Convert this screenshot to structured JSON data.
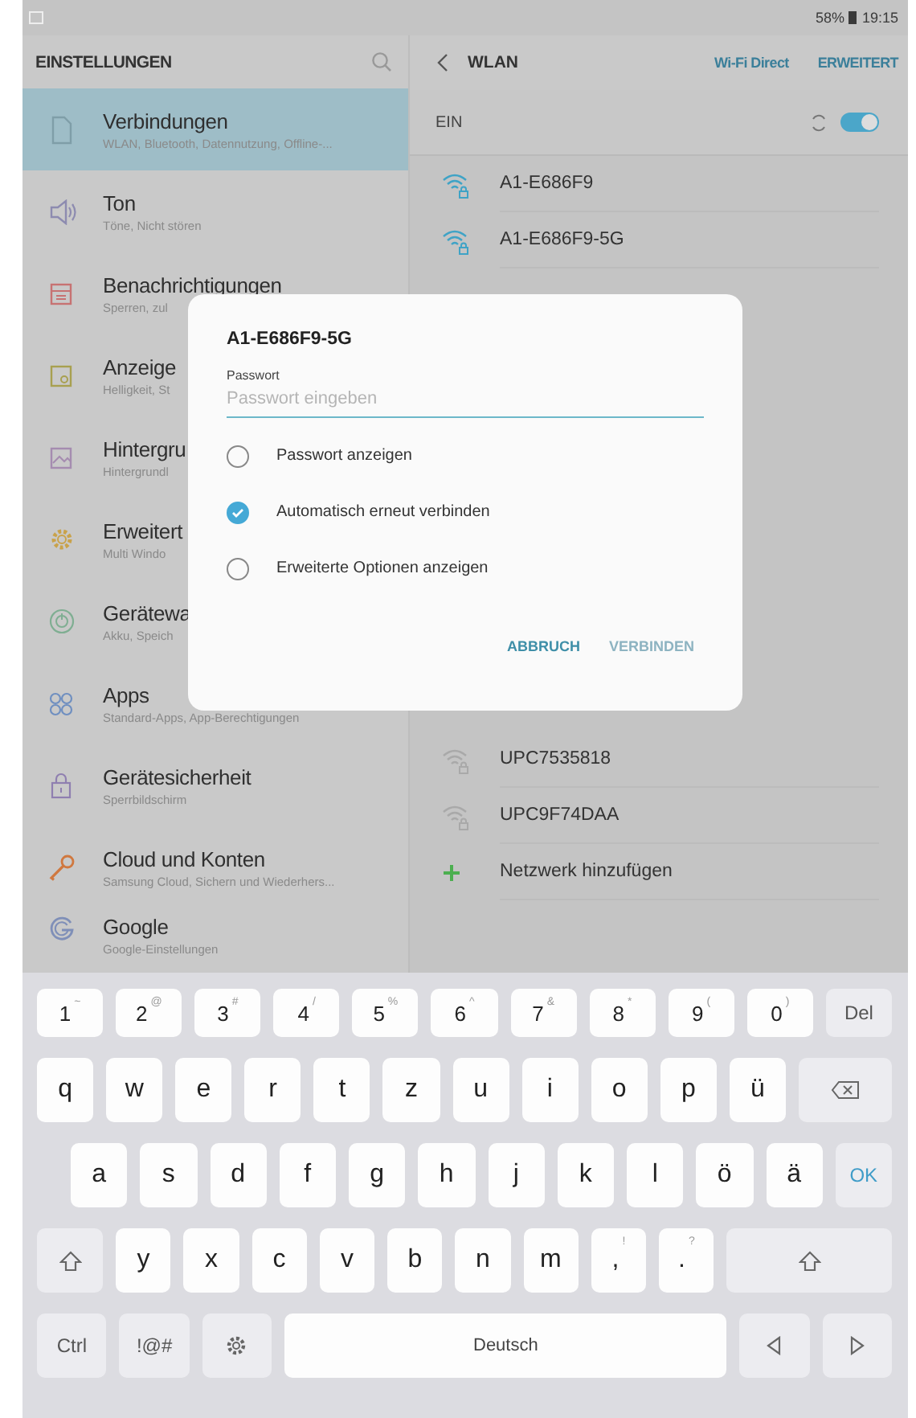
{
  "status_bar": {
    "battery": "58%",
    "time": "19:15"
  },
  "sidebar": {
    "title": "EINSTELLUNGEN",
    "items": [
      {
        "kind": "connections",
        "title": "Verbindungen",
        "subtitle": "WLAN, Bluetooth, Datennutzung, Offline-...",
        "selected": true
      },
      {
        "kind": "sound",
        "title": "Ton",
        "subtitle": "Töne, Nicht stören",
        "selected": false
      },
      {
        "kind": "notifications",
        "title": "Benachrichtigungen",
        "subtitle": "Sperren, zul",
        "selected": false
      },
      {
        "kind": "display",
        "title": "Anzeige",
        "subtitle": "Helligkeit, St",
        "selected": false
      },
      {
        "kind": "wallpaper",
        "title": "Hintergru",
        "subtitle": "Hintergrundl",
        "selected": false
      },
      {
        "kind": "advanced",
        "title": "Erweitert",
        "subtitle": "Multi Windo",
        "selected": false
      },
      {
        "kind": "maintenance",
        "title": "Gerätewa",
        "subtitle": "Akku, Speich",
        "selected": false
      },
      {
        "kind": "apps",
        "title": "Apps",
        "subtitle": "Standard-Apps, App-Berechtigungen",
        "selected": false
      },
      {
        "kind": "security",
        "title": "Gerätesicherheit",
        "subtitle": "Sperrbildschirm",
        "selected": false
      },
      {
        "kind": "cloud",
        "title": "Cloud und Konten",
        "subtitle": "Samsung Cloud, Sichern und Wiederhers...",
        "selected": false
      },
      {
        "kind": "google",
        "title": "Google",
        "subtitle": "Google-Einstellungen",
        "selected": false
      }
    ]
  },
  "wlan": {
    "title": "WLAN",
    "actions": [
      "Wi-Fi Direct",
      "ERWEITERT"
    ],
    "switch": {
      "label": "EIN",
      "on": true
    },
    "networks": [
      {
        "kind": "network",
        "name": "A1-E686F9",
        "color": "#3fa3c6"
      },
      {
        "kind": "network",
        "name": "A1-E686F9-5G",
        "color": "#3fa3c6"
      },
      {
        "kind": "network",
        "name": "UPC7535818",
        "color": "#a9a9a9"
      },
      {
        "kind": "network",
        "name": "UPC9F74DAA",
        "color": "#a9a9a9"
      },
      {
        "kind": "add",
        "name": "Netzwerk hinzufügen",
        "color": "#4caf50"
      }
    ]
  },
  "dialog": {
    "title": "A1-E686F9-5G",
    "field": {
      "label": "Passwort",
      "placeholder": "Passwort eingeben"
    },
    "options": [
      {
        "label": "Passwort anzeigen",
        "checked": false
      },
      {
        "label": "Automatisch erneut verbinden",
        "checked": true
      },
      {
        "label": "Erweiterte Optionen anzeigen",
        "checked": false
      }
    ],
    "buttons": [
      {
        "label": "ABBRUCH",
        "disabled": false
      },
      {
        "label": "VERBINDEN",
        "disabled": true
      }
    ]
  },
  "keyboard": {
    "number_keys": [
      {
        "kind": "char",
        "label": "1",
        "alt": "~"
      },
      {
        "kind": "char",
        "label": "2",
        "alt": "@"
      },
      {
        "kind": "char",
        "label": "3",
        "alt": "#"
      },
      {
        "kind": "char",
        "label": "4",
        "alt": "/"
      },
      {
        "kind": "char",
        "label": "5",
        "alt": "%"
      },
      {
        "kind": "char",
        "label": "6",
        "alt": "^"
      },
      {
        "kind": "char",
        "label": "7",
        "alt": "&"
      },
      {
        "kind": "char",
        "label": "8",
        "alt": "*"
      },
      {
        "kind": "char",
        "label": "9",
        "alt": "("
      },
      {
        "kind": "char",
        "label": "0",
        "alt": ")"
      },
      {
        "kind": "func",
        "label": "Del"
      }
    ],
    "top_letter_keys": [
      {
        "kind": "char",
        "label": "q"
      },
      {
        "kind": "char",
        "label": "w"
      },
      {
        "kind": "char",
        "label": "e"
      },
      {
        "kind": "char",
        "label": "r"
      },
      {
        "kind": "char",
        "label": "t"
      },
      {
        "kind": "char",
        "label": "z"
      },
      {
        "kind": "char",
        "label": "u"
      },
      {
        "kind": "char",
        "label": "i"
      },
      {
        "kind": "char",
        "label": "o"
      },
      {
        "kind": "char",
        "label": "p"
      },
      {
        "kind": "char",
        "label": "ü"
      },
      {
        "kind": "backspace"
      }
    ],
    "middle_letter_keys": [
      {
        "kind": "char",
        "label": "a"
      },
      {
        "kind": "char",
        "label": "s"
      },
      {
        "kind": "char",
        "label": "d"
      },
      {
        "kind": "char",
        "label": "f"
      },
      {
        "kind": "char",
        "label": "g"
      },
      {
        "kind": "char",
        "label": "h"
      },
      {
        "kind": "char",
        "label": "j"
      },
      {
        "kind": "char",
        "label": "k"
      },
      {
        "kind": "char",
        "label": "l"
      },
      {
        "kind": "char",
        "label": "ö"
      },
      {
        "kind": "char",
        "label": "ä"
      },
      {
        "kind": "ok",
        "label": "OK"
      }
    ],
    "bottom_letter_keys": [
      {
        "kind": "shift"
      },
      {
        "kind": "char",
        "label": "y"
      },
      {
        "kind": "char",
        "label": "x"
      },
      {
        "kind": "char",
        "label": "c"
      },
      {
        "kind": "char",
        "label": "v"
      },
      {
        "kind": "char",
        "label": "b"
      },
      {
        "kind": "char",
        "label": "n"
      },
      {
        "kind": "char",
        "label": "m"
      },
      {
        "kind": "char",
        "label": ",",
        "alt": "!"
      },
      {
        "kind": "char",
        "label": ".",
        "alt": "?"
      },
      {
        "kind": "shift"
      }
    ],
    "function_keys": [
      {
        "kind": "func",
        "label": "Ctrl"
      },
      {
        "kind": "func",
        "label": "!@#"
      },
      {
        "kind": "settings"
      },
      {
        "kind": "space",
        "label": "Deutsch"
      },
      {
        "kind": "left"
      },
      {
        "kind": "right"
      }
    ]
  }
}
